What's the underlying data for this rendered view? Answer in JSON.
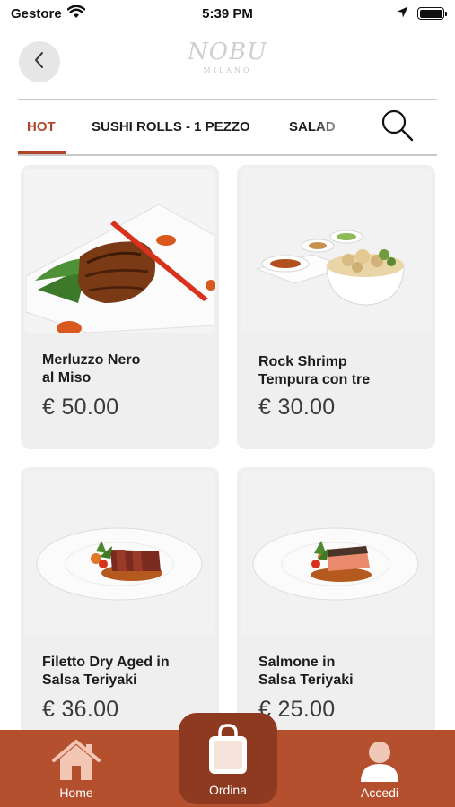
{
  "status_bar": {
    "carrier": "Gestore",
    "time": "5:39 PM",
    "icons": [
      "wifi-icon",
      "location-arrow-icon",
      "battery-icon"
    ]
  },
  "header": {
    "logo_main": "NOBU",
    "logo_sub": "MILANO",
    "back_icon": "chevron-left-icon"
  },
  "tabs": [
    {
      "label": "HOT",
      "active": true
    },
    {
      "label": "SUSHI ROLLS - 1 PEZZO",
      "active": false
    },
    {
      "label": "SALAD",
      "active": false
    }
  ],
  "search_icon": "search-icon",
  "products": [
    {
      "name": "Merluzzo Nero\nal Miso",
      "price": "€ 50.00",
      "image": "miso-black-cod-photo"
    },
    {
      "name": "Rock Shrimp\nTempura con tre",
      "price": "€ 30.00",
      "image": "rock-shrimp-tempura-photo"
    },
    {
      "name": "Filetto Dry Aged in\nSalsa Teriyaki",
      "price": "€ 36.00",
      "image": "beef-teriyaki-photo"
    },
    {
      "name": "Salmone in\nSalsa Teriyaki",
      "price": "€ 25.00",
      "image": "salmon-teriyaki-photo"
    }
  ],
  "bottom_nav": {
    "home_label": "Home",
    "order_label": "Ordina",
    "login_label": "Accedi"
  },
  "colors": {
    "accent": "#b0452b",
    "bottom_bar": "#b5502f",
    "order_button": "#8e3a20",
    "card_bg": "#efefef"
  }
}
